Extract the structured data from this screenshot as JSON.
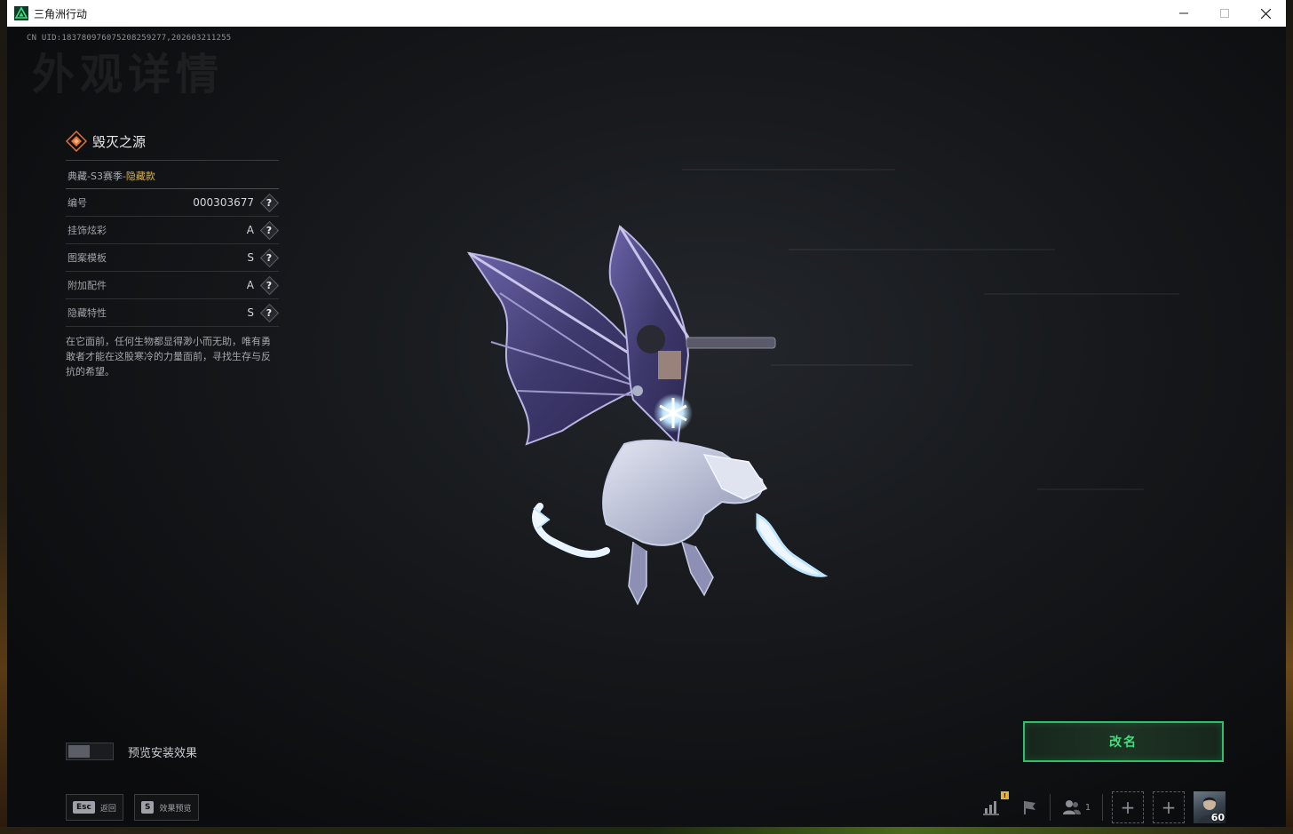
{
  "window": {
    "title": "三角洲行动",
    "controls": [
      "minimize",
      "maximize",
      "close"
    ]
  },
  "header": {
    "uid": "CN UID:1837809760752082592​77,202603211255",
    "ghost_title": "外观详情"
  },
  "item": {
    "name": "毁灭之源",
    "series_prefix": "典藏-S3赛季-",
    "series_tag": "隐藏款",
    "rows": [
      {
        "label": "编号",
        "value": "000303677"
      },
      {
        "label": "挂饰炫彩",
        "value": "A"
      },
      {
        "label": "图案模板",
        "value": "S"
      },
      {
        "label": "附加配件",
        "value": "A"
      },
      {
        "label": "隐藏特性",
        "value": "S"
      }
    ],
    "help_glyph": "?",
    "description": "在它面前，任何生物都显得渺小而无助，唯有勇敢者才能在这股寒冷的力量面前，寻找生存与反抗的希望。"
  },
  "preview": {
    "label": "预览安装效果",
    "enabled": false
  },
  "hints": [
    {
      "key": "Esc",
      "label": "返回"
    },
    {
      "key": "S",
      "label": "效果预览"
    }
  ],
  "rename_button": {
    "label": "改名"
  },
  "statusbar": {
    "notice_badge": "!",
    "friends_count": "1",
    "player_level": "60"
  },
  "colors": {
    "accent_green": "#2fc06b",
    "hidden_gold": "#e3b241"
  }
}
